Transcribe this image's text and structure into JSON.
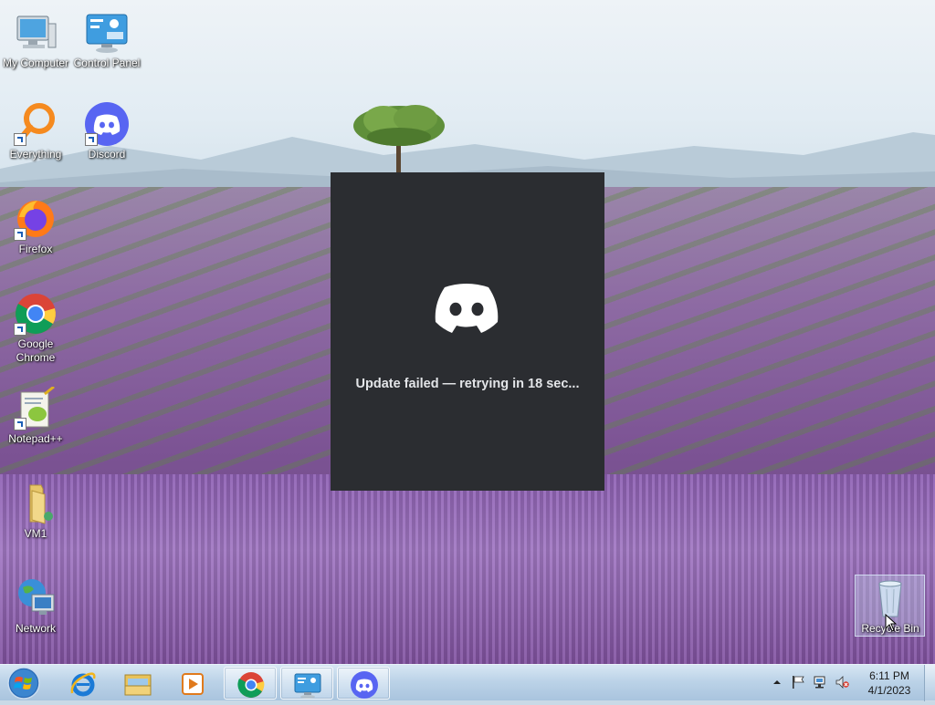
{
  "desktop": {
    "icons": [
      {
        "label": "My Computer",
        "icon": "my-computer-icon"
      },
      {
        "label": "Control Panel",
        "icon": "control-panel-icon"
      },
      {
        "label": "Everything",
        "icon": "everything-search-icon"
      },
      {
        "label": "Discord",
        "icon": "discord-icon"
      },
      {
        "label": "Firefox",
        "icon": "firefox-icon"
      },
      {
        "label": "Google Chrome",
        "icon": "chrome-icon"
      },
      {
        "label": "Notepad++",
        "icon": "notepad-plus-plus-icon"
      },
      {
        "label": "VM1",
        "icon": "folder-icon"
      },
      {
        "label": "Network",
        "icon": "network-icon"
      },
      {
        "label": "Recycle Bin",
        "icon": "recycle-bin-icon"
      }
    ]
  },
  "discord_updater": {
    "status_text": "Update failed — retrying in 18 sec...",
    "background": "#2b2d31"
  },
  "taskbar": {
    "items": [
      {
        "name": "start-button"
      },
      {
        "name": "internet-explorer"
      },
      {
        "name": "windows-explorer"
      },
      {
        "name": "media-player"
      },
      {
        "name": "google-chrome"
      },
      {
        "name": "control-panel"
      },
      {
        "name": "discord"
      }
    ],
    "clock": {
      "time": "6:11 PM",
      "date": "4/1/2023"
    }
  }
}
